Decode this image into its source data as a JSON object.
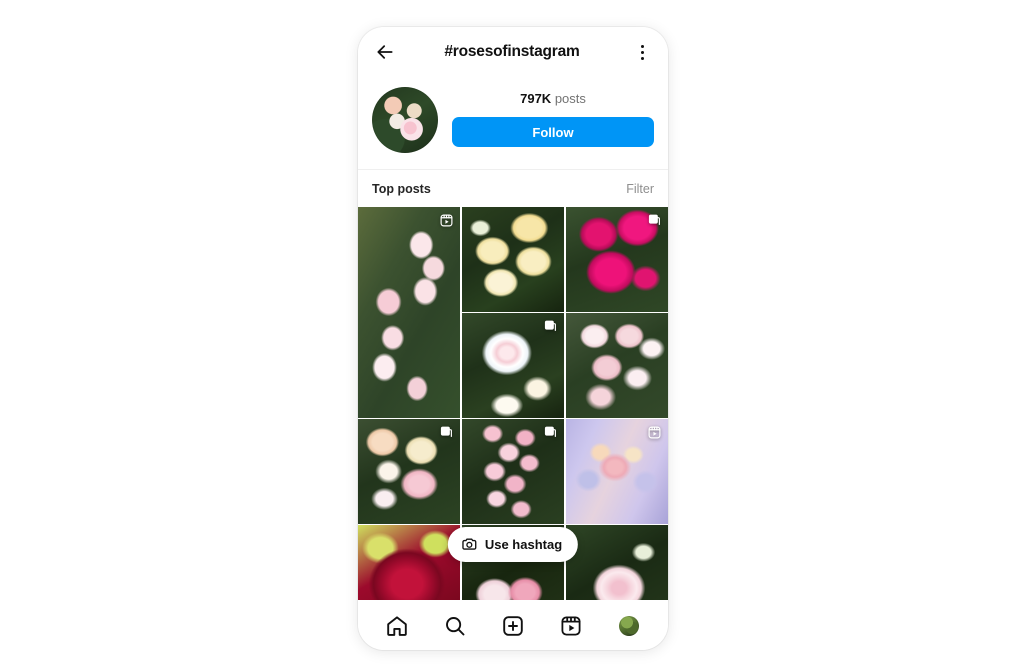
{
  "header": {
    "back_icon": "arrow-left-icon",
    "title": "#rosesofinstagram",
    "menu_icon": "more-vertical-icon"
  },
  "profile": {
    "avatar_icon": "hashtag-avatar",
    "posts_count": "797K",
    "posts_label": "posts",
    "follow_label": "Follow",
    "follow_color": "#0095f6"
  },
  "section": {
    "title": "Top posts",
    "filter_label": "Filter"
  },
  "grid": {
    "cells": [
      {
        "name": "post-garden-pink-roses",
        "style": "p-gardenpink",
        "span": "tall",
        "badge": "reels-icon"
      },
      {
        "name": "post-cream-yellow-roses",
        "style": "p-creamyellow",
        "span": "std",
        "badge": ""
      },
      {
        "name": "post-magenta-roses",
        "style": "p-magenta",
        "span": "std",
        "badge": "carousel-icon"
      },
      {
        "name": "post-white-blue-rose",
        "style": "p-whiteblue",
        "span": "std",
        "badge": "carousel-icon"
      },
      {
        "name": "post-pale-rose-cluster",
        "style": "p-palecluster",
        "span": "std",
        "badge": ""
      },
      {
        "name": "post-apricot-pink-roses",
        "style": "p-apricot",
        "span": "std",
        "badge": "carousel-icon"
      },
      {
        "name": "post-pink-climbing-roses",
        "style": "p-pinkclimber",
        "span": "std",
        "badge": "carousel-icon"
      },
      {
        "name": "post-pastel-bouquet",
        "style": "p-bouquet",
        "span": "std",
        "badge": "reels-icon"
      },
      {
        "name": "post-dark-red-rose",
        "style": "p-darkred",
        "span": "std",
        "badge": ""
      },
      {
        "name": "post-pink-rose-bud",
        "style": "p-budpink",
        "span": "std",
        "badge": ""
      },
      {
        "name": "post-pink-open-rose",
        "style": "p-pinkrose",
        "span": "std",
        "badge": ""
      }
    ]
  },
  "use_hashtag": {
    "camera_icon": "camera-icon",
    "label": "Use hashtag"
  },
  "bottom_nav": {
    "items": [
      {
        "name": "nav-home",
        "icon": "home-icon"
      },
      {
        "name": "nav-search",
        "icon": "search-icon"
      },
      {
        "name": "nav-create",
        "icon": "plus-square-icon"
      },
      {
        "name": "nav-reels",
        "icon": "reels-icon"
      },
      {
        "name": "nav-profile",
        "icon": "profile-avatar"
      }
    ]
  }
}
